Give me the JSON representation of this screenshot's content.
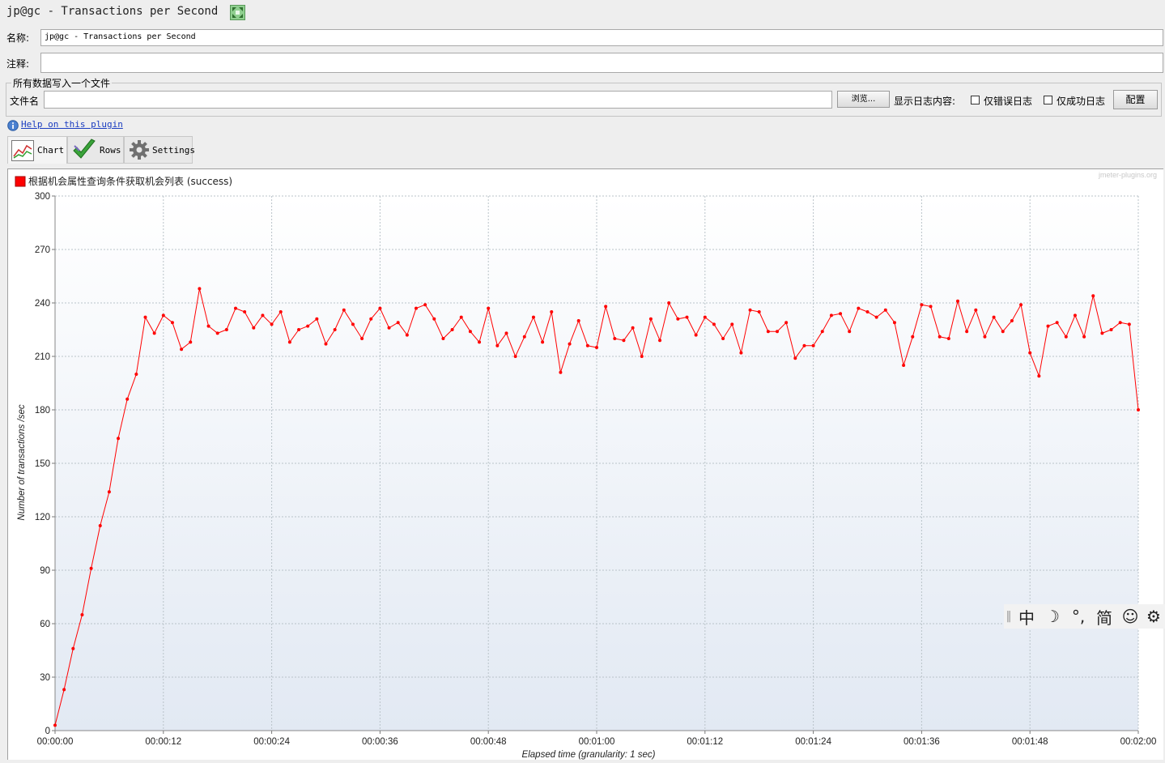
{
  "window": {
    "title": "jp@gc - Transactions per Second",
    "icon": "expand-icon"
  },
  "form": {
    "name_label": "名称:",
    "name_value": "jp@gc - Transactions per Second",
    "comment_label": "注释:",
    "comment_value": ""
  },
  "file_group": {
    "legend": "所有数据写入一个文件",
    "filename_label": "文件名",
    "filename_value": "",
    "browse_label": "浏览...",
    "log_label": "显示日志内容:",
    "errors_only_label": "仅错误日志",
    "errors_only_checked": false,
    "success_only_label": "仅成功日志",
    "success_only_checked": false,
    "config_label": "配置"
  },
  "help": {
    "label": "Help on this plugin",
    "icon": "info-icon"
  },
  "tabs": [
    {
      "label": "Chart",
      "icon": "chart-icon",
      "active": true
    },
    {
      "label": "Rows",
      "icon": "checkmark-icon",
      "active": false
    },
    {
      "label": "Settings",
      "icon": "gear-icon",
      "active": false
    }
  ],
  "ime_toolbar": {
    "items": [
      "中",
      "☽",
      "°,",
      "简",
      "☺",
      "⚙"
    ]
  },
  "chart_data": {
    "type": "line",
    "watermark": "jmeter-plugins.org",
    "xlabel": "Elapsed time (granularity: 1 sec)",
    "ylabel": "Number of transactions /sec",
    "ylim": [
      0,
      300
    ],
    "xlim": [
      0,
      120
    ],
    "yticks": [
      0,
      30,
      60,
      90,
      120,
      150,
      180,
      210,
      240,
      270,
      300
    ],
    "xticks": [
      0,
      12,
      24,
      36,
      48,
      60,
      72,
      84,
      96,
      108,
      120
    ],
    "xtick_labels": [
      "00:00:00",
      "00:00:12",
      "00:00:24",
      "00:00:36",
      "00:00:48",
      "00:01:00",
      "00:01:12",
      "00:01:24",
      "00:01:36",
      "00:01:48",
      "00:02:00"
    ],
    "legend_position": "top-left",
    "grid": true,
    "series": [
      {
        "name": "根据机会属性查询条件获取机会列表 (success)",
        "color": "#ff0000",
        "values": [
          3,
          23,
          46,
          65,
          91,
          115,
          134,
          164,
          186,
          200,
          232,
          223,
          233,
          229,
          214,
          218,
          248,
          227,
          223,
          225,
          237,
          235,
          226,
          233,
          228,
          235,
          218,
          225,
          227,
          231,
          217,
          225,
          236,
          228,
          220,
          231,
          237,
          226,
          229,
          222,
          237,
          239,
          231,
          220,
          225,
          232,
          224,
          218,
          237,
          216,
          223,
          210,
          221,
          232,
          218,
          235,
          201,
          217,
          230,
          216,
          215,
          238,
          220,
          219,
          226,
          210,
          231,
          219,
          240,
          231,
          232,
          222,
          232,
          228,
          220,
          228,
          212,
          236,
          235,
          224,
          224,
          229,
          209,
          216,
          216,
          224,
          233,
          234,
          224,
          237,
          235,
          232,
          236,
          229,
          205,
          221,
          239,
          238,
          221,
          220,
          241,
          224,
          236,
          221,
          232,
          224,
          230,
          239,
          212,
          199,
          227,
          229,
          221,
          233,
          221,
          244,
          223,
          225,
          229,
          228,
          180
        ]
      }
    ]
  }
}
